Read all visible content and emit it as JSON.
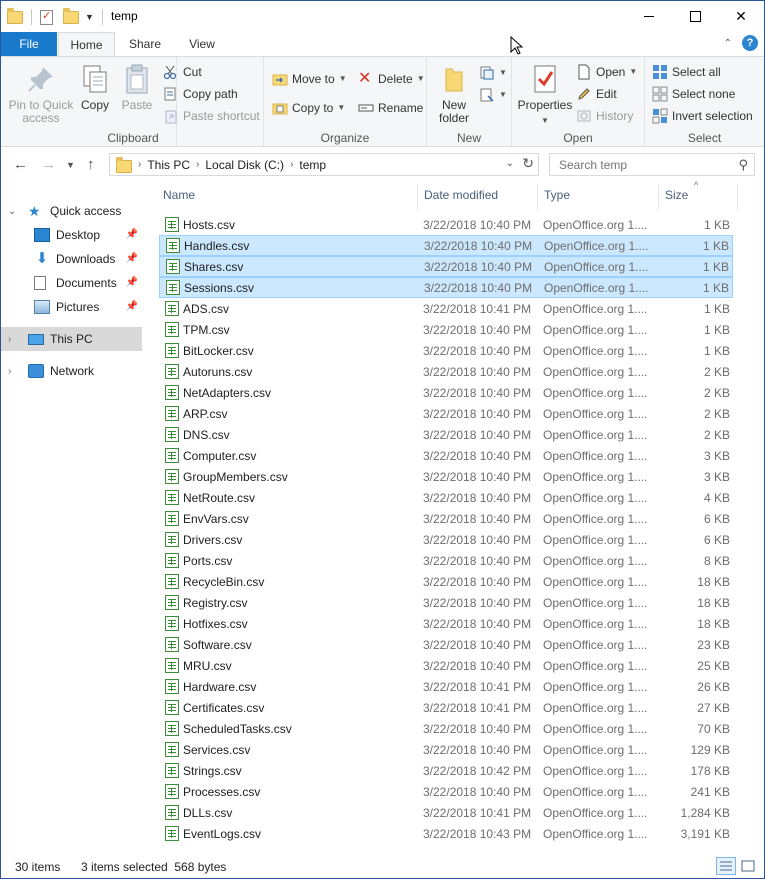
{
  "window": {
    "title": "temp"
  },
  "ribbon_tabs": {
    "file": "File",
    "home": "Home",
    "share": "Share",
    "view": "View"
  },
  "ribbon": {
    "clipboard": {
      "label": "Clipboard",
      "pin": "Pin to Quick access",
      "copy": "Copy",
      "paste": "Paste",
      "cut": "Cut",
      "copy_path": "Copy path",
      "paste_shortcut": "Paste shortcut"
    },
    "organize": {
      "label": "Organize",
      "move_to": "Move to",
      "copy_to": "Copy to",
      "delete": "Delete",
      "rename": "Rename"
    },
    "new": {
      "label": "New",
      "new_folder": "New folder"
    },
    "open": {
      "label": "Open",
      "properties": "Properties",
      "open": "Open",
      "edit": "Edit",
      "history": "History"
    },
    "select": {
      "label": "Select",
      "select_all": "Select all",
      "select_none": "Select none",
      "invert": "Invert selection"
    }
  },
  "address": {
    "crumbs": [
      "This PC",
      "Local Disk (C:)",
      "temp"
    ]
  },
  "search": {
    "placeholder": "Search temp"
  },
  "nav": {
    "quick_access": "Quick access",
    "desktop": "Desktop",
    "downloads": "Downloads",
    "documents": "Documents",
    "pictures": "Pictures",
    "this_pc": "This PC",
    "network": "Network"
  },
  "columns": {
    "name": "Name",
    "date": "Date modified",
    "type": "Type",
    "size": "Size"
  },
  "files": [
    {
      "name": "Hosts.csv",
      "date": "3/22/2018 10:40 PM",
      "type": "OpenOffice.org 1....",
      "size": "1 KB",
      "selected": false
    },
    {
      "name": "Handles.csv",
      "date": "3/22/2018 10:40 PM",
      "type": "OpenOffice.org 1....",
      "size": "1 KB",
      "selected": true
    },
    {
      "name": "Shares.csv",
      "date": "3/22/2018 10:40 PM",
      "type": "OpenOffice.org 1....",
      "size": "1 KB",
      "selected": true
    },
    {
      "name": "Sessions.csv",
      "date": "3/22/2018 10:40 PM",
      "type": "OpenOffice.org 1....",
      "size": "1 KB",
      "selected": true
    },
    {
      "name": "ADS.csv",
      "date": "3/22/2018 10:41 PM",
      "type": "OpenOffice.org 1....",
      "size": "1 KB",
      "selected": false
    },
    {
      "name": "TPM.csv",
      "date": "3/22/2018 10:40 PM",
      "type": "OpenOffice.org 1....",
      "size": "1 KB",
      "selected": false
    },
    {
      "name": "BitLocker.csv",
      "date": "3/22/2018 10:40 PM",
      "type": "OpenOffice.org 1....",
      "size": "1 KB",
      "selected": false
    },
    {
      "name": "Autoruns.csv",
      "date": "3/22/2018 10:40 PM",
      "type": "OpenOffice.org 1....",
      "size": "2 KB",
      "selected": false
    },
    {
      "name": "NetAdapters.csv",
      "date": "3/22/2018 10:40 PM",
      "type": "OpenOffice.org 1....",
      "size": "2 KB",
      "selected": false
    },
    {
      "name": "ARP.csv",
      "date": "3/22/2018 10:40 PM",
      "type": "OpenOffice.org 1....",
      "size": "2 KB",
      "selected": false
    },
    {
      "name": "DNS.csv",
      "date": "3/22/2018 10:40 PM",
      "type": "OpenOffice.org 1....",
      "size": "2 KB",
      "selected": false
    },
    {
      "name": "Computer.csv",
      "date": "3/22/2018 10:40 PM",
      "type": "OpenOffice.org 1....",
      "size": "3 KB",
      "selected": false
    },
    {
      "name": "GroupMembers.csv",
      "date": "3/22/2018 10:40 PM",
      "type": "OpenOffice.org 1....",
      "size": "3 KB",
      "selected": false
    },
    {
      "name": "NetRoute.csv",
      "date": "3/22/2018 10:40 PM",
      "type": "OpenOffice.org 1....",
      "size": "4 KB",
      "selected": false
    },
    {
      "name": "EnvVars.csv",
      "date": "3/22/2018 10:40 PM",
      "type": "OpenOffice.org 1....",
      "size": "6 KB",
      "selected": false
    },
    {
      "name": "Drivers.csv",
      "date": "3/22/2018 10:40 PM",
      "type": "OpenOffice.org 1....",
      "size": "6 KB",
      "selected": false
    },
    {
      "name": "Ports.csv",
      "date": "3/22/2018 10:40 PM",
      "type": "OpenOffice.org 1....",
      "size": "8 KB",
      "selected": false
    },
    {
      "name": "RecycleBin.csv",
      "date": "3/22/2018 10:40 PM",
      "type": "OpenOffice.org 1....",
      "size": "18 KB",
      "selected": false
    },
    {
      "name": "Registry.csv",
      "date": "3/22/2018 10:40 PM",
      "type": "OpenOffice.org 1....",
      "size": "18 KB",
      "selected": false
    },
    {
      "name": "Hotfixes.csv",
      "date": "3/22/2018 10:40 PM",
      "type": "OpenOffice.org 1....",
      "size": "18 KB",
      "selected": false
    },
    {
      "name": "Software.csv",
      "date": "3/22/2018 10:40 PM",
      "type": "OpenOffice.org 1....",
      "size": "23 KB",
      "selected": false
    },
    {
      "name": "MRU.csv",
      "date": "3/22/2018 10:40 PM",
      "type": "OpenOffice.org 1....",
      "size": "25 KB",
      "selected": false
    },
    {
      "name": "Hardware.csv",
      "date": "3/22/2018 10:41 PM",
      "type": "OpenOffice.org 1....",
      "size": "26 KB",
      "selected": false
    },
    {
      "name": "Certificates.csv",
      "date": "3/22/2018 10:41 PM",
      "type": "OpenOffice.org 1....",
      "size": "27 KB",
      "selected": false
    },
    {
      "name": "ScheduledTasks.csv",
      "date": "3/22/2018 10:40 PM",
      "type": "OpenOffice.org 1....",
      "size": "70 KB",
      "selected": false
    },
    {
      "name": "Services.csv",
      "date": "3/22/2018 10:40 PM",
      "type": "OpenOffice.org 1....",
      "size": "129 KB",
      "selected": false
    },
    {
      "name": "Strings.csv",
      "date": "3/22/2018 10:42 PM",
      "type": "OpenOffice.org 1....",
      "size": "178 KB",
      "selected": false
    },
    {
      "name": "Processes.csv",
      "date": "3/22/2018 10:40 PM",
      "type": "OpenOffice.org 1....",
      "size": "241 KB",
      "selected": false
    },
    {
      "name": "DLLs.csv",
      "date": "3/22/2018 10:41 PM",
      "type": "OpenOffice.org 1....",
      "size": "1,284 KB",
      "selected": false
    },
    {
      "name": "EventLogs.csv",
      "date": "3/22/2018 10:43 PM",
      "type": "OpenOffice.org 1....",
      "size": "3,191 KB",
      "selected": false
    }
  ],
  "status": {
    "count": "30 items",
    "selection": "3 items selected  568 bytes"
  },
  "colors": {
    "accent": "#1979ca",
    "selected_row": "#cce8ff",
    "selected_border": "#99d1ff"
  }
}
